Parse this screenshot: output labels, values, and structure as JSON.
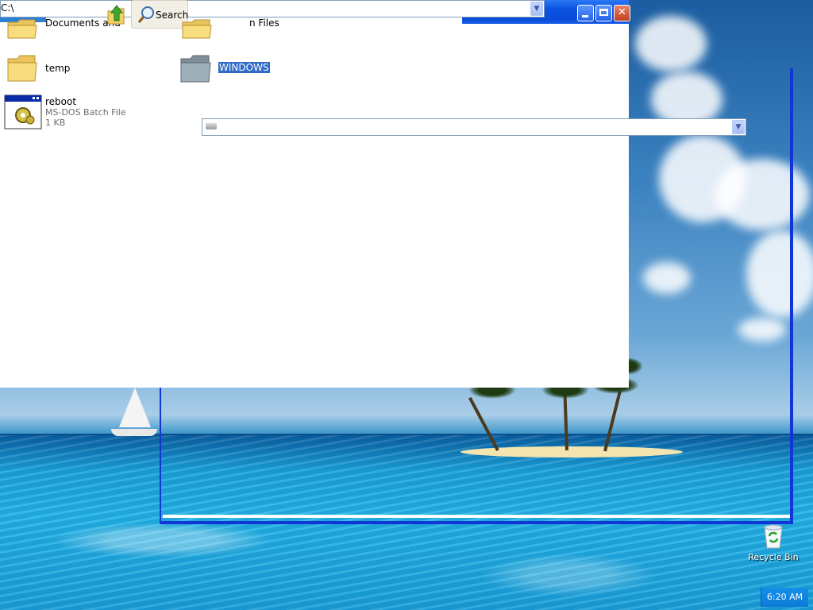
{
  "address_bar": {
    "path": "C:\\"
  },
  "toolbar": {
    "search_label": "Search"
  },
  "files": [
    {
      "name": "Documents and Settings",
      "visible_text": "Documents and",
      "type": "folder"
    },
    {
      "name": "Program Files",
      "visible_text": "n Files",
      "type": "folder"
    },
    {
      "name": "temp",
      "type": "folder"
    },
    {
      "name": "WINDOWS",
      "type": "folder",
      "selected": true
    },
    {
      "name": "reboot",
      "type": "MS-DOS Batch File",
      "size": "1 KB"
    }
  ],
  "desktop": {
    "recycle_bin_label": "Recycle Bin"
  },
  "taskbar": {
    "clock": "6:20 AM"
  },
  "colors": {
    "selection": "#316ac5",
    "titlebar": "#0a52e0",
    "taskbar": "#0d7bd8"
  }
}
